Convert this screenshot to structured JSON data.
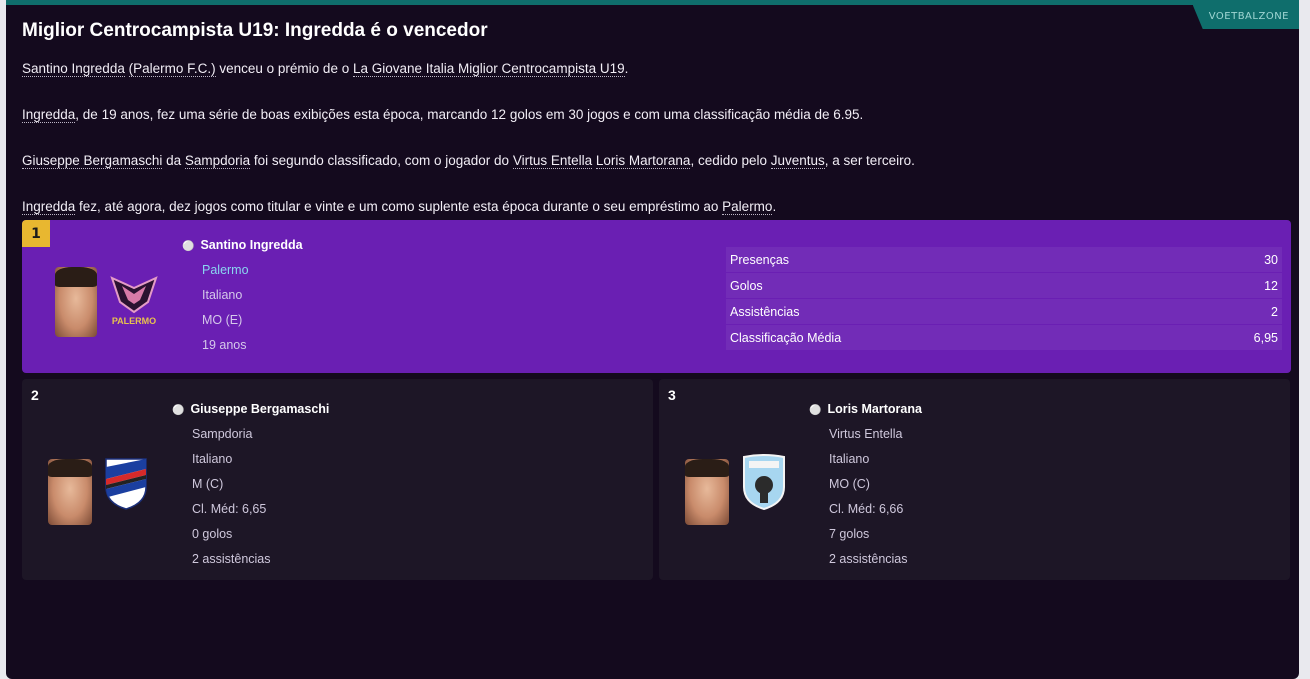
{
  "header": {
    "tag": "VOETBALZONE",
    "title": "Miglior Centrocampista U19: Ingredda é o vencedor"
  },
  "article": {
    "p1": {
      "player": "Santino Ingredda",
      "club": "(Palermo F.C.)",
      "mid": " venceu o prémio de o ",
      "award": "La Giovane Italia Miglior Centrocampista U19",
      "end": "."
    },
    "p2": {
      "player": "Ingredda",
      "text": ", de 19 anos, fez uma série de boas exibições esta época, marcando 12 golos em 30 jogos e com uma classificação média de 6.95."
    },
    "p3": {
      "player": "Giuseppe Bergamaschi",
      "t1": " da ",
      "club": "Sampdoria",
      "t2": " foi segundo classificado, com o jogador do ",
      "club2": "Virtus Entella",
      "sp": " ",
      "player2": "Loris Martorana",
      "t3": ", cedido pelo ",
      "club3": "Juventus",
      "t4": ", a ser terceiro."
    },
    "p4": {
      "player": "Ingredda",
      "text": " fez, até agora, dez jogos como titular e vinte e um como suplente esta época durante o seu empréstimo ao ",
      "club": "Palermo",
      "end": "."
    }
  },
  "winner": {
    "rank": "1",
    "name": "Santino Ingredda",
    "club": "Palermo",
    "nationality": "Italiano",
    "position": "MO (E)",
    "age": "19 anos",
    "crest_text": "PALERMO",
    "stats": [
      {
        "label": "Presenças",
        "value": "30"
      },
      {
        "label": "Golos",
        "value": "12"
      },
      {
        "label": "Assistências",
        "value": "2"
      },
      {
        "label": "Classificação Média",
        "value": "6,95"
      }
    ]
  },
  "second": {
    "rank": "2",
    "name": "Giuseppe Bergamaschi",
    "club": "Sampdoria",
    "nationality": "Italiano",
    "position": "M (C)",
    "rating": "Cl. Méd: 6,65",
    "goals": "0 golos",
    "assists": "2 assistências"
  },
  "third": {
    "rank": "3",
    "name": "Loris Martorana",
    "club": "Virtus Entella",
    "nationality": "Italiano",
    "position": "MO (C)",
    "rating": "Cl. Méd: 6,66",
    "goals": "7 golos",
    "assists": "2 assistências"
  },
  "colors": {
    "accent": "#0f6e6c",
    "winner_bg": "#6a1fb3",
    "rank1_badge": "#e8b730",
    "panel_bg": "#140a1e"
  }
}
